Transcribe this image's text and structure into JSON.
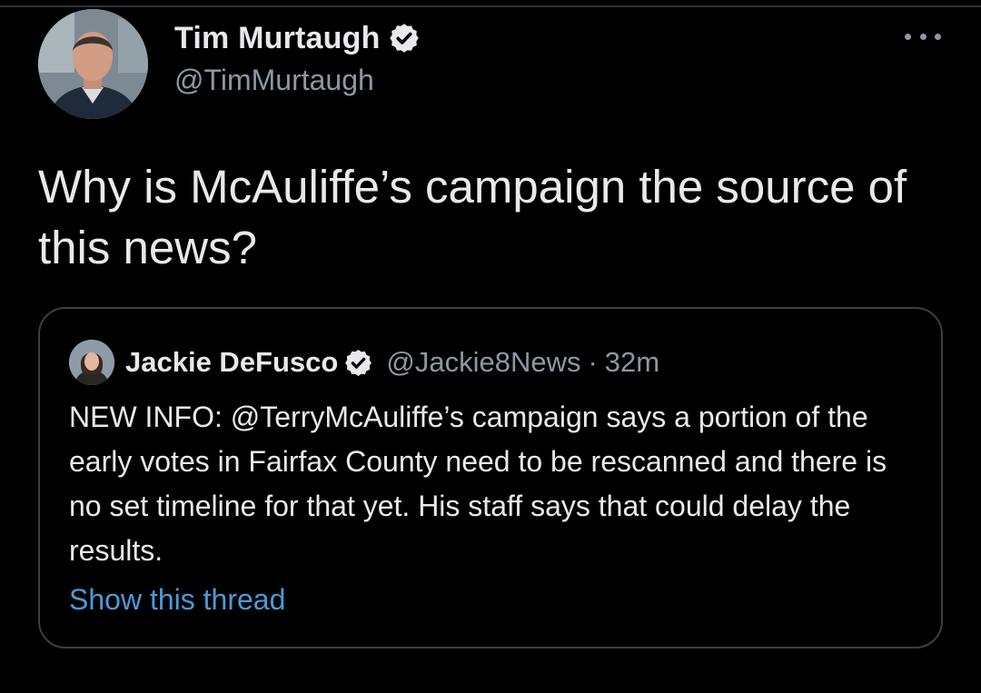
{
  "tweet": {
    "author": {
      "display_name": "Tim Murtaugh",
      "handle": "@TimMurtaugh",
      "verified": true,
      "avatar_icon": "profile-photo"
    },
    "more_icon": "ellipsis-icon",
    "text": "Why is McAuliffe’s campaign the source of this news?"
  },
  "quoted_tweet": {
    "author": {
      "display_name": "Jackie DeFusco",
      "handle": "@Jackie8News",
      "verified": true,
      "avatar_icon": "profile-photo"
    },
    "separator": "·",
    "timestamp": "32m",
    "text": "NEW INFO: @TerryMcAuliffe’s campaign says a portion of the early votes in Fairfax County need to be rescanned and there is no set timeline for that yet. His staff says that could delay the results.",
    "show_thread_label": "Show this thread"
  },
  "colors": {
    "background": "#000000",
    "primary_text": "#e7e9ea",
    "secondary_text": "#8b98a5",
    "link": "#4a9ad8",
    "border": "#3a3f44"
  }
}
